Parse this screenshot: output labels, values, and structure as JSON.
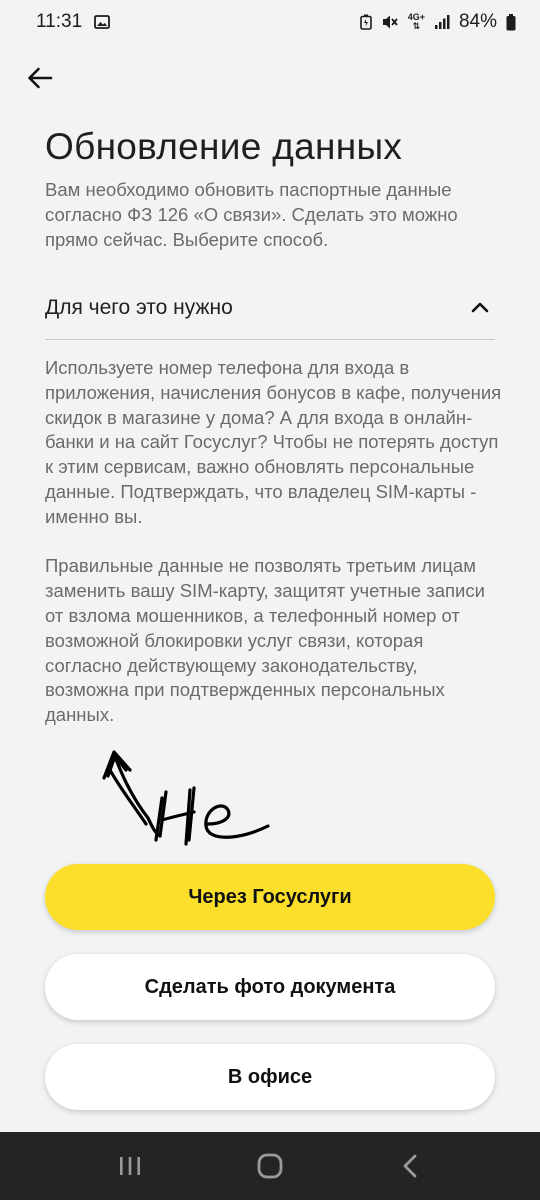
{
  "status_bar": {
    "time": "11:31",
    "network": "4G+",
    "battery": "84%"
  },
  "header": {
    "title": "Обновление данных",
    "subtitle": "Вам необходимо обновить паспортные данные согласно ФЗ 126 «О связи». Сделать это можно прямо сейчас. Выберите способ."
  },
  "accordion": {
    "title": "Для чего это нужно",
    "expanded": true,
    "paragraph_1": "Используете номер телефона для входа в приложения, начисления бонусов в кафе, получения скидок в магазине у дома? А для входа в онлайн-банки и на сайт Госуслуг? Чтобы не потерять доступ к этим сервисам, важно обновлять персональные данные. Подтверждать, что владелец SIM-карты - именно вы.",
    "paragraph_2": "Правильные данные не позволять третьим лицам заменить вашу SIM-карту, защитят учетные записи от взлома мошенников, а телефонный номер от возможной блокировки услуг связи, которая согласно действующему законодательству, возможна при подтвержденных персональных данных."
  },
  "handwritten_note": "He",
  "buttons": {
    "gosuslugi": "Через Госуслуги",
    "photo": "Сделать фото документа",
    "office": "В офисе"
  },
  "colors": {
    "background": "#f2f3f5",
    "primary_button": "#fbdf2b",
    "secondary_button": "#ffffff",
    "navbar": "#242424"
  },
  "icons": {
    "back": "arrow-left-icon",
    "accordion_toggle": "chevron-up-icon",
    "nav_recents": "recents-icon",
    "nav_home": "home-icon",
    "nav_back": "back-icon"
  }
}
